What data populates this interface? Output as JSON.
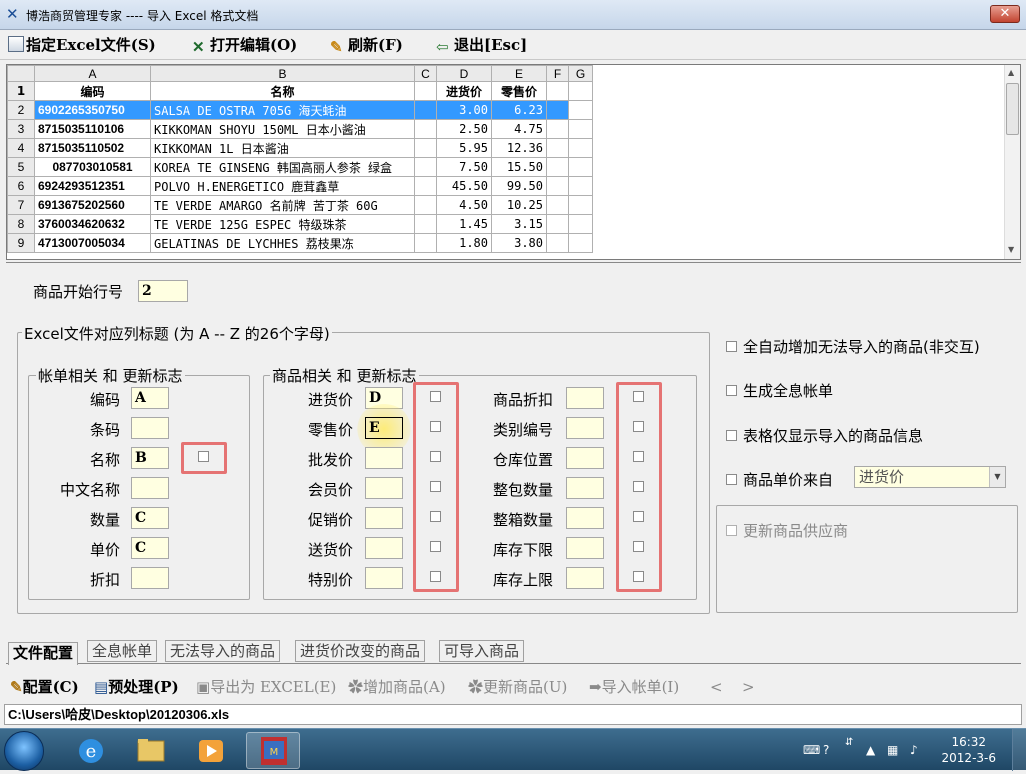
{
  "window": {
    "title": "博浩商贸管理专家 ---- 导入 Excel 格式文档",
    "close_label": "✕"
  },
  "toolbar": {
    "specify": "指定Excel文件(S)",
    "open_edit": "打开编辑(O)",
    "refresh": "刷新(F)",
    "exit": "退出[Esc]"
  },
  "sheet": {
    "columns": [
      "A",
      "B",
      "C",
      "D",
      "E",
      "F",
      "G"
    ],
    "rows": [
      {
        "rn": "1",
        "code": "编码",
        "name": "名称",
        "c": "",
        "buy": "进货价",
        "sell": "零售价"
      },
      {
        "rn": "2",
        "code": "6902265350750",
        "name": "SALSA DE OSTRA 705G 海天蚝油",
        "c": "",
        "buy": "3.00",
        "sell": "6.23"
      },
      {
        "rn": "3",
        "code": "8715035110106",
        "name": "KIKKOMAN SHOYU 150ML 日本小酱油",
        "c": "",
        "buy": "2.50",
        "sell": "4.75"
      },
      {
        "rn": "4",
        "code": "8715035110502",
        "name": "KIKKOMAN 1L 日本酱油",
        "c": "",
        "buy": "5.95",
        "sell": "12.36"
      },
      {
        "rn": "5",
        "code": "087703010581",
        "name": "KOREA TE GINSENG 韩国高丽人参茶 绿盒",
        "c": "",
        "buy": "7.50",
        "sell": "15.50"
      },
      {
        "rn": "6",
        "code": "6924293512351",
        "name": "POLVO H.ENERGETICO 鹿茸鑫草",
        "c": "",
        "buy": "45.50",
        "sell": "99.50"
      },
      {
        "rn": "7",
        "code": "6913675202560",
        "name": "TE VERDE AMARGO 名前牌 苦丁茶 60G",
        "c": "",
        "buy": "4.50",
        "sell": "10.25"
      },
      {
        "rn": "8",
        "code": "3760034620632",
        "name": "TE VERDE 125G ESPEC 特级珠茶",
        "c": "",
        "buy": "1.45",
        "sell": "3.15"
      },
      {
        "rn": "9",
        "code": "4713007005034",
        "name": "GELATINAS DE LYCHHES 荔枝果冻",
        "c": "",
        "buy": "1.80",
        "sell": "3.80"
      }
    ]
  },
  "config": {
    "start_row_label": "商品开始行号",
    "start_row_value": "2",
    "excel_group_title": "Excel文件对应列标题 (为 A -- Z 的26个字母)",
    "bill_group_title": "帐单相关  和  更新标志",
    "goods_group_title": "商品相关  和  更新标志",
    "bill_fields": [
      {
        "label": "编码",
        "value": "A"
      },
      {
        "label": "条码",
        "value": ""
      },
      {
        "label": "名称",
        "value": "B"
      },
      {
        "label": "中文名称",
        "value": ""
      },
      {
        "label": "数量",
        "value": "C"
      },
      {
        "label": "单价",
        "value": "C"
      },
      {
        "label": "折扣",
        "value": ""
      }
    ],
    "goods_fields_1": [
      {
        "label": "进货价",
        "value": "D"
      },
      {
        "label": "零售价",
        "value": "E"
      },
      {
        "label": "批发价",
        "value": ""
      },
      {
        "label": "会员价",
        "value": ""
      },
      {
        "label": "促销价",
        "value": ""
      },
      {
        "label": "送货价",
        "value": ""
      },
      {
        "label": "特别价",
        "value": ""
      }
    ],
    "goods_fields_2": [
      {
        "label": "商品折扣",
        "value": ""
      },
      {
        "label": "类别编号",
        "value": ""
      },
      {
        "label": "仓库位置",
        "value": ""
      },
      {
        "label": "整包数量",
        "value": ""
      },
      {
        "label": "整箱数量",
        "value": ""
      },
      {
        "label": "库存下限",
        "value": ""
      },
      {
        "label": "库存上限",
        "value": ""
      }
    ],
    "options": [
      {
        "label": "全自动增加无法导入的商品(非交互)"
      },
      {
        "label": "生成全息帐单"
      },
      {
        "label": "表格仅显示导入的商品信息"
      },
      {
        "label": "商品单价来自"
      }
    ],
    "price_source": "进货价",
    "update_supplier": "更新商品供应商"
  },
  "tabs": [
    "文件配置",
    "全息帐单",
    "无法导入的商品",
    "进货价改变的商品",
    "可导入商品"
  ],
  "bottom": {
    "config": "配置(C)",
    "preprocess": "预处理(P)",
    "export": "导出为 EXCEL(E)",
    "add": "增加商品(A)",
    "update": "更新商品(U)",
    "import": "导入帐单(I)",
    "prev": "<",
    "next": ">"
  },
  "status": {
    "path": "C:\\Users\\哈皮\\Desktop\\20120306.xls"
  },
  "taskbar": {
    "time": "16:32",
    "date": "2012-3-6"
  },
  "colors": {
    "selection": "#3399ff",
    "input_bg": "#ffffe1",
    "highlight_box": "#e57373"
  }
}
